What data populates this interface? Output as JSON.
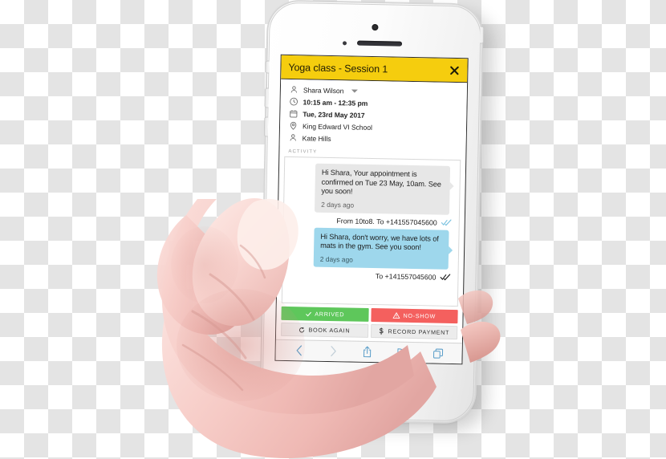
{
  "app": {
    "title": "Yoga class - Session 1",
    "close_icon": "close-icon"
  },
  "details": [
    {
      "icon": "person-icon",
      "text": "Shara Wilson",
      "bold": false,
      "has_caret": true
    },
    {
      "icon": "clock-icon",
      "text": "10:15 am - 12:35 pm",
      "bold": true,
      "has_caret": false
    },
    {
      "icon": "calendar-icon",
      "text": "Tue, 23rd May 2017",
      "bold": true,
      "has_caret": false
    },
    {
      "icon": "location-icon",
      "text": "King Edward VI School",
      "bold": false,
      "has_caret": false
    },
    {
      "icon": "person-icon",
      "text": "Kate Hills",
      "bold": false,
      "has_caret": false
    }
  ],
  "activity": {
    "label": "ACTIVITY",
    "messages": [
      {
        "body": "Hi Shara, Your appointment is confirmed on Tue 23 May, 10am. See you soon!",
        "time": "2 days ago",
        "style": "grey",
        "meta": "From 10to8. To  +141557045600",
        "meta_ticks": "blue"
      },
      {
        "body": "Hi Shara, don't worry, we have lots of mats in the gym. See you soon!",
        "time": "2 days ago",
        "style": "blue",
        "meta": "To  +141557045600",
        "meta_ticks": "dark"
      }
    ]
  },
  "actions": [
    {
      "label": "ARRIVED",
      "icon": "check-icon",
      "style": "green"
    },
    {
      "label": "NO-SHOW",
      "icon": "warning-icon",
      "style": "red"
    },
    {
      "label": "BOOK AGAIN",
      "icon": "refresh-icon",
      "style": "grey"
    },
    {
      "label": "RECORD PAYMENT",
      "icon": "dollar-icon",
      "style": "grey"
    }
  ],
  "safari_toolbar": [
    {
      "icon": "back-chevron-icon",
      "enabled": true
    },
    {
      "icon": "forward-chevron-icon",
      "enabled": false
    },
    {
      "icon": "share-icon",
      "enabled": true
    },
    {
      "icon": "bookmarks-book-icon",
      "enabled": true
    },
    {
      "icon": "tabs-icon",
      "enabled": true
    }
  ],
  "device": {
    "type": "smartphone",
    "home_button": "home-button",
    "front_camera": "front-camera",
    "earpiece": "earpiece"
  },
  "colors": {
    "header_yellow": "#f5cd0e",
    "bubble_grey": "#e7e7e7",
    "bubble_blue": "#9ed7ec",
    "arrived_green": "#5ec75b",
    "noshow_red": "#f4605e",
    "safari_blue": "#5b9ec9"
  }
}
